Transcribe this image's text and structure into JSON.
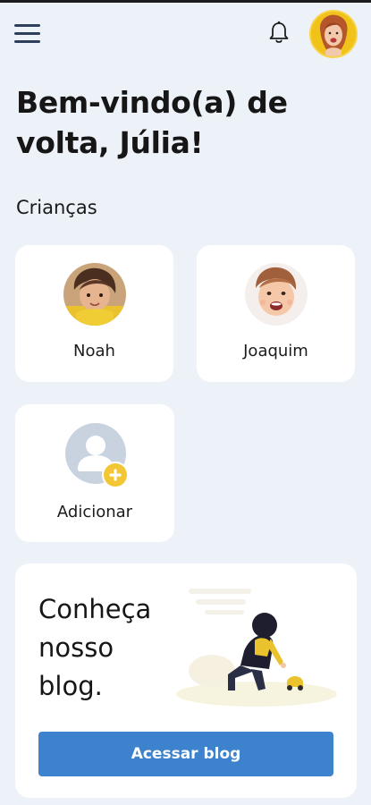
{
  "header": {
    "menu_icon": "hamburger-menu-icon",
    "notification_icon": "bell-icon",
    "avatar_description": "user-avatar-julia"
  },
  "greeting": {
    "line1": "Bem-vindo(a) de",
    "line2": "volta, Júlia!"
  },
  "children_section": {
    "title": "Crianças",
    "children": [
      {
        "name": "Noah"
      },
      {
        "name": "Joaquim"
      }
    ],
    "add_label": "Adicionar",
    "add_icon": "add-person-icon"
  },
  "blog": {
    "title_lines": [
      "Conheça",
      "nosso",
      "blog."
    ],
    "button_label": "Acessar blog"
  },
  "colors": {
    "background": "#edf2f9",
    "card": "#ffffff",
    "primary_button": "#3d82cc",
    "accent_yellow": "#f2c733",
    "menu_icon": "#2f3e5b"
  }
}
